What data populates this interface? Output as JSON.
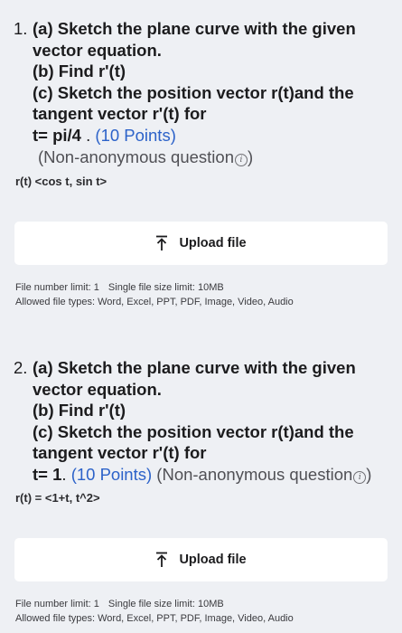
{
  "questions": [
    {
      "number": "1.",
      "lines": [
        "(a) Sketch the plane curve with the given",
        "vector equation.",
        "(b) Find r'(t)",
        "(c) Sketch the position vector r(t)and the",
        "tangent vector r'(t) for"
      ],
      "last_line_bold": "t= pi/4",
      "last_line_sep": " . ",
      "points": "(10 Points)",
      "nonanon": "(Non-anonymous question",
      "nonanon_end": ")",
      "answer": "r(t) <cos t, sin t>",
      "upload_label": "Upload file",
      "file_number_limit": "File number limit: 1",
      "file_size_limit": "Single file size limit: 10MB",
      "file_types": "Allowed file types: Word, Excel, PPT, PDF, Image, Video, Audio"
    },
    {
      "number": "2.",
      "lines": [
        "(a) Sketch the plane curve with the given",
        "vector equation.",
        "(b) Find r'(t)",
        "(c) Sketch the position vector r(t)and the",
        "tangent vector r'(t) for"
      ],
      "last_line_bold": "t= 1",
      "last_line_sep": ". ",
      "points": "(10 Points)",
      "nonanon": "(Non-anonymous question",
      "nonanon_end": ")",
      "answer": "r(t) = <1+t, t^2>",
      "upload_label": "Upload file",
      "file_number_limit": "File number limit: 1",
      "file_size_limit": "Single file size limit: 10MB",
      "file_types": "Allowed file types: Word, Excel, PPT, PDF, Image, Video, Audio"
    }
  ],
  "icons": {
    "info": "info-icon",
    "upload": "upload-arrow-icon"
  },
  "colors": {
    "background": "#eef0f4",
    "points": "#2c62c9",
    "button_bg": "#ffffff"
  }
}
